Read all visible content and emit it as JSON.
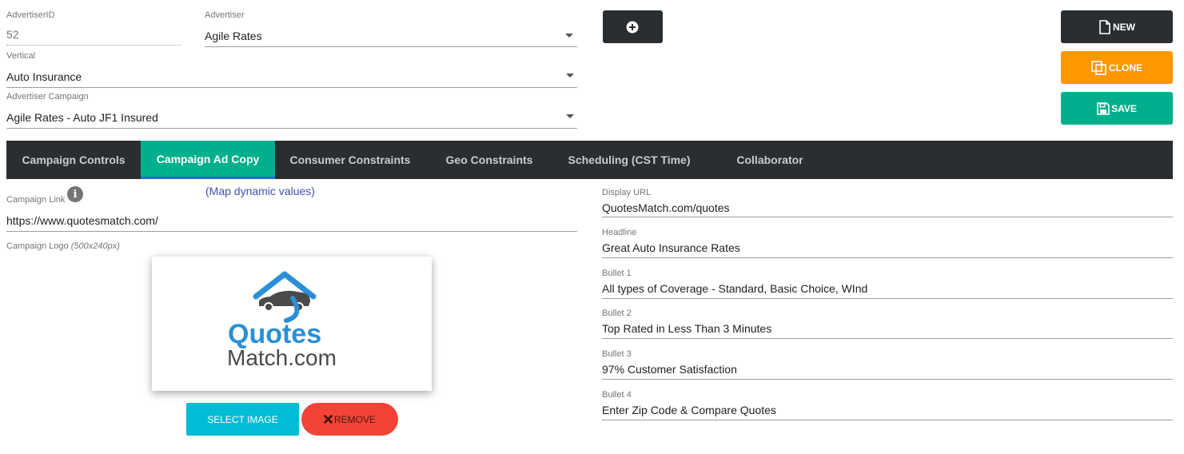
{
  "header": {
    "advertiser_id": {
      "label": "AdvertiserID",
      "value": "52"
    },
    "advertiser": {
      "label": "Advertiser",
      "value": "Agile Rates"
    },
    "vertical": {
      "label": "Vertical",
      "value": "Auto Insurance"
    },
    "advertiser_campaign": {
      "label": "Advertiser Campaign",
      "value": "Agile Rates - Auto JF1 Insured"
    }
  },
  "actions": {
    "add_icon": "plus-circle-icon",
    "new_label": "NEW",
    "clone_label": "CLONE",
    "save_label": "SAVE",
    "colors": {
      "new": "#2b2e30",
      "clone": "#ff9800",
      "save": "#00b08c"
    }
  },
  "tabs": [
    {
      "label": "Campaign Controls",
      "active": false
    },
    {
      "label": "Campaign Ad Copy",
      "active": true
    },
    {
      "label": "Consumer Constraints",
      "active": false
    },
    {
      "label": "Geo Constraints",
      "active": false
    },
    {
      "label": "Scheduling (CST Time)",
      "active": false
    },
    {
      "label": "Collaborator",
      "active": false
    }
  ],
  "ad_copy": {
    "campaign_link": {
      "label": "Campaign Link",
      "value": "https://www.quotesmatch.com/"
    },
    "map_dynamic_values": "(Map dynamic values)",
    "campaign_logo": {
      "label": "Campaign Logo",
      "hint": "(500x240px)"
    },
    "logo": {
      "line1": "Quotes",
      "line2": "Match.com"
    },
    "select_image_label": "SELECT IMAGE",
    "remove_label": "REMOVE",
    "display_url": {
      "label": "Display URL",
      "value": "QuotesMatch.com/quotes"
    },
    "headline": {
      "label": "Headline",
      "value": "Great Auto Insurance Rates"
    },
    "bullet1": {
      "label": "Bullet 1",
      "value": "All types of Coverage - Standard, Basic Choice, WInd"
    },
    "bullet2": {
      "label": "Bullet 2",
      "value": "Top Rated in Less Than 3 Minutes"
    },
    "bullet3": {
      "label": "Bullet 3",
      "value": "97% Customer Satisfaction"
    },
    "bullet4": {
      "label": "Bullet 4",
      "value": "Enter Zip Code & Compare Quotes"
    }
  }
}
